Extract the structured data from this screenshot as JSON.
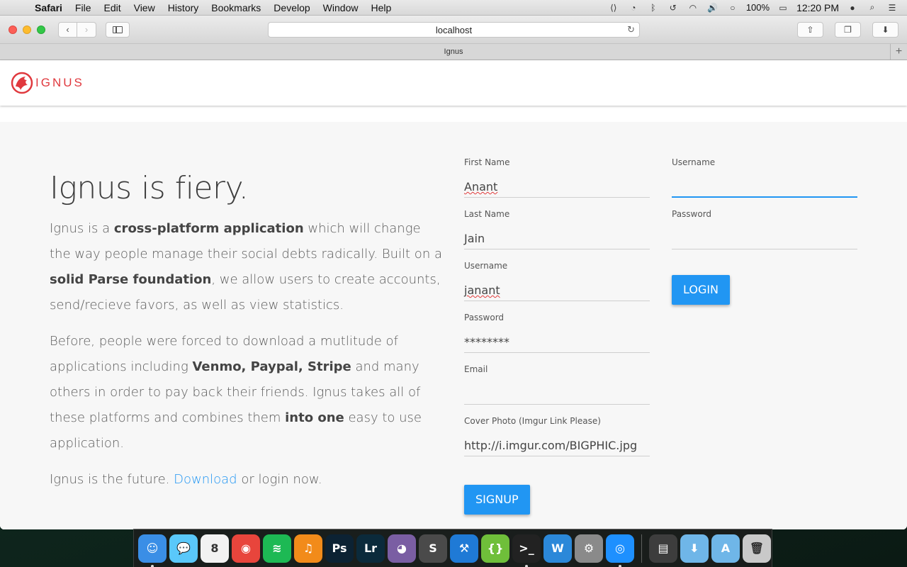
{
  "menubar": {
    "apple": "",
    "app_name": "Safari",
    "menus": [
      "File",
      "Edit",
      "View",
      "History",
      "Bookmarks",
      "Develop",
      "Window",
      "Help"
    ],
    "battery": "100%",
    "clock": "12:20 PM"
  },
  "browser": {
    "url": "localhost",
    "tab_title": "Ignus"
  },
  "site": {
    "logo_text": "IGNUS",
    "colors": {
      "brand": "#e0393e",
      "accent": "#2196f3"
    }
  },
  "intro": {
    "heading": "Ignus is fiery.",
    "p1": [
      {
        "t": "Ignus is a ",
        "b": false
      },
      {
        "t": "cross-platform application",
        "b": true
      },
      {
        "t": " which will change the way people manage their social debts radically. Built on a ",
        "b": false
      },
      {
        "t": "solid Parse foundation",
        "b": true
      },
      {
        "t": ", we allow users to create accounts, send/recieve favors, as well as view statistics.",
        "b": false
      }
    ],
    "p2": [
      {
        "t": "Before, people were forced to download a mutlitude of applications including ",
        "b": false
      },
      {
        "t": "Venmo, Paypal, Stripe",
        "b": true
      },
      {
        "t": " and many others in order to pay back their friends. Ignus takes all of these platforms and combines them ",
        "b": false
      },
      {
        "t": "into one",
        "b": true
      },
      {
        "t": " easy to use application.",
        "b": false
      }
    ],
    "p3_before": "Ignus is the future. ",
    "p3_link": "Download",
    "p3_after": " or login now."
  },
  "signup": {
    "first_name": {
      "label": "First Name",
      "value": "Anant"
    },
    "last_name": {
      "label": "Last Name",
      "value": "Jain"
    },
    "username": {
      "label": "Username",
      "value": "janant"
    },
    "password": {
      "label": "Password",
      "value": "********"
    },
    "email": {
      "label": "Email",
      "value": ""
    },
    "cover_photo": {
      "label": "Cover Photo (Imgur Link Please)",
      "value": "http://i.imgur.com/BIGPHIC.jpg"
    },
    "button": "Signup"
  },
  "login": {
    "username": {
      "label": "Username",
      "value": ""
    },
    "password": {
      "label": "Password",
      "value": ""
    },
    "button": "Login"
  },
  "dock": {
    "apps": [
      {
        "icon": "finder-icon",
        "glyph": "☺",
        "color": "#3a8ee6",
        "running": true
      },
      {
        "icon": "messages-icon",
        "glyph": "💬",
        "color": "#5ac8fa",
        "running": false
      },
      {
        "icon": "calendar-icon",
        "glyph": "8",
        "color": "#f2f2f2",
        "running": false
      },
      {
        "icon": "chrome-icon",
        "glyph": "◉",
        "color": "#e8453c",
        "running": false
      },
      {
        "icon": "spotify-icon",
        "glyph": "≋",
        "color": "#1db954",
        "running": false
      },
      {
        "icon": "headphones-icon",
        "glyph": "♫",
        "color": "#f28b1a",
        "running": false
      },
      {
        "icon": "photoshop-icon",
        "glyph": "Ps",
        "color": "#0c2233",
        "running": false
      },
      {
        "icon": "lightroom-icon",
        "glyph": "Lr",
        "color": "#0b2a3b",
        "running": false
      },
      {
        "icon": "github-icon",
        "glyph": "◕",
        "color": "#7a5ea3",
        "running": false
      },
      {
        "icon": "sublime-icon",
        "glyph": "S",
        "color": "#4a4a4a",
        "running": false
      },
      {
        "icon": "xcode-icon",
        "glyph": "⚒",
        "color": "#1f7ad6",
        "running": false
      },
      {
        "icon": "brackets-icon",
        "glyph": "{}",
        "color": "#6fbf3a",
        "running": false
      },
      {
        "icon": "terminal-icon",
        "glyph": ">_",
        "color": "#222222",
        "running": true
      },
      {
        "icon": "wunderlist-icon",
        "glyph": "W",
        "color": "#2b88d9",
        "running": false
      },
      {
        "icon": "system-preferences-icon",
        "glyph": "⚙",
        "color": "#8a8a8a",
        "running": false
      },
      {
        "icon": "safari-icon",
        "glyph": "◎",
        "color": "#1e90ff",
        "running": true
      }
    ],
    "stacks": [
      {
        "icon": "folder-stack-icon",
        "glyph": "▤",
        "color": "#3d3d3d"
      },
      {
        "icon": "downloads-folder-icon",
        "glyph": "⬇",
        "color": "#6fb6e8"
      },
      {
        "icon": "applications-folder-icon",
        "glyph": "A",
        "color": "#6fb6e8"
      },
      {
        "icon": "trash-icon",
        "glyph": "🗑",
        "color": "#c9c9c9"
      }
    ]
  }
}
